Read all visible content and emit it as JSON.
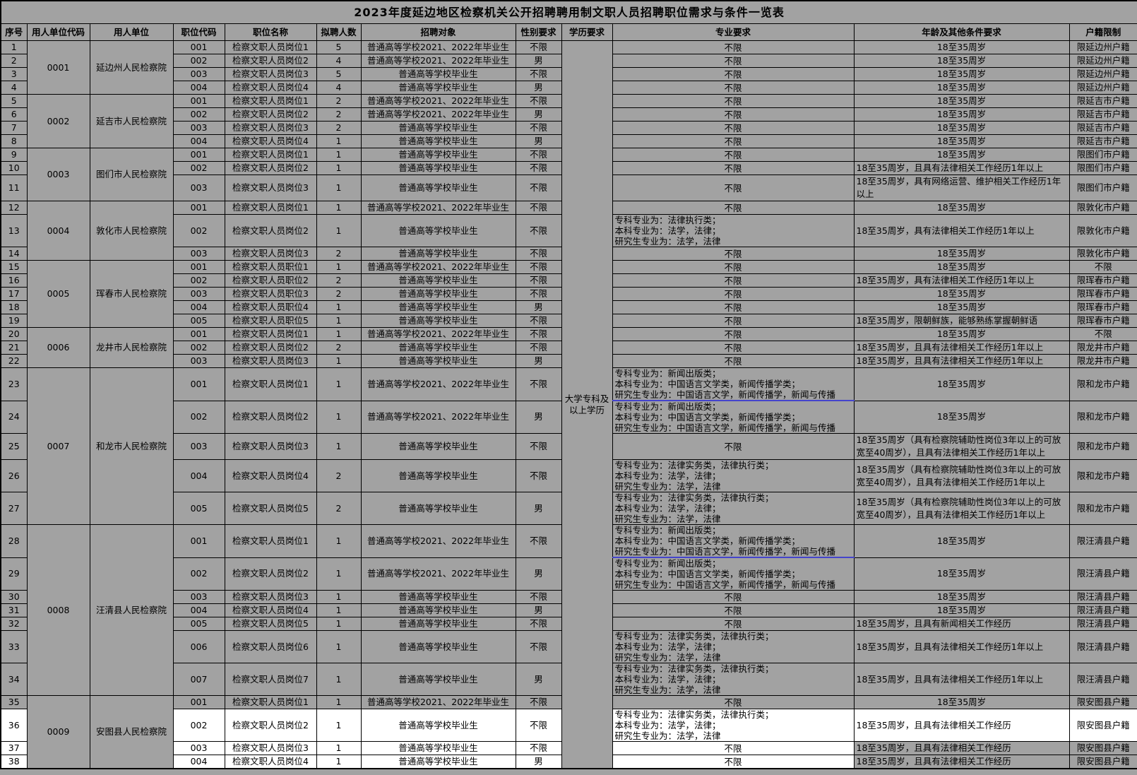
{
  "title": "2023年度延边地区检察机关公开招聘聘用制文职人员招聘职位需求与条件一览表",
  "columns": [
    "序号",
    "用人单位代码",
    "用人单位",
    "职位代码",
    "职位名称",
    "拟聘人数",
    "招聘对象",
    "性别要求",
    "学历要求",
    "专业要求",
    "年龄及其他条件要求",
    "户籍限制"
  ],
  "education_requirement": "大学专科及以上学历",
  "colors": {
    "cell_gray": "#a2a2a2",
    "highlight_white": "#ffffff",
    "border_black": "#000000",
    "blue_accent_border": "#4444cc"
  },
  "groups": [
    {
      "code": "0001",
      "employer": "延边州人民检察院",
      "rows": [
        {
          "no": "1",
          "post_code": "001",
          "post_name": "检察文职人员岗位1",
          "count": "5",
          "target": "普通高等学校2021、2022年毕业生",
          "gender": "不限",
          "major": "不限",
          "age": "18至35周岁",
          "residence": "限延边州户籍"
        },
        {
          "no": "2",
          "post_code": "002",
          "post_name": "检察文职人员岗位2",
          "count": "4",
          "target": "普通高等学校2021、2022年毕业生",
          "gender": "男",
          "major": "不限",
          "age": "18至35周岁",
          "residence": "限延边州户籍"
        },
        {
          "no": "3",
          "post_code": "003",
          "post_name": "检察文职人员岗位3",
          "count": "5",
          "target": "普通高等学校毕业生",
          "gender": "不限",
          "major": "不限",
          "age": "18至35周岁",
          "residence": "限延边州户籍"
        },
        {
          "no": "4",
          "post_code": "004",
          "post_name": "检察文职人员岗位4",
          "count": "4",
          "target": "普通高等学校毕业生",
          "gender": "男",
          "major": "不限",
          "age": "18至35周岁",
          "residence": "限延边州户籍"
        }
      ]
    },
    {
      "code": "0002",
      "employer": "延吉市人民检察院",
      "rows": [
        {
          "no": "5",
          "post_code": "001",
          "post_name": "检察文职人员岗位1",
          "count": "2",
          "target": "普通高等学校2021、2022年毕业生",
          "gender": "不限",
          "major": "不限",
          "age": "18至35周岁",
          "residence": "限延吉市户籍"
        },
        {
          "no": "6",
          "post_code": "002",
          "post_name": "检察文职人员岗位2",
          "count": "2",
          "target": "普通高等学校2021、2022年毕业生",
          "gender": "男",
          "major": "不限",
          "age": "18至35周岁",
          "residence": "限延吉市户籍"
        },
        {
          "no": "7",
          "post_code": "003",
          "post_name": "检察文职人员岗位3",
          "count": "2",
          "target": "普通高等学校毕业生",
          "gender": "不限",
          "major": "不限",
          "age": "18至35周岁",
          "residence": "限延吉市户籍"
        },
        {
          "no": "8",
          "post_code": "004",
          "post_name": "检察文职人员岗位4",
          "count": "1",
          "target": "普通高等学校毕业生",
          "gender": "男",
          "major": "不限",
          "age": "18至35周岁",
          "residence": "限延吉市户籍"
        }
      ]
    },
    {
      "code": "0003",
      "employer": "图们市人民检察院",
      "rows": [
        {
          "no": "9",
          "post_code": "001",
          "post_name": "检察文职人员岗位1",
          "count": "1",
          "target": "普通高等学校毕业生",
          "gender": "不限",
          "major": "不限",
          "age": "18至35周岁",
          "residence": "限图们市户籍"
        },
        {
          "no": "10",
          "post_code": "002",
          "post_name": "检察文职人员岗位2",
          "count": "1",
          "target": "普通高等学校毕业生",
          "gender": "不限",
          "major": "不限",
          "age": "18至35周岁，且具有法律相关工作经历1年以上",
          "residence": "限图们市户籍"
        },
        {
          "no": "11",
          "post_code": "003",
          "post_name": "检察文职人员岗位3",
          "count": "1",
          "target": "普通高等学校毕业生",
          "gender": "不限",
          "major": "不限",
          "age": "18至35周岁，具有网络运营、维护相关工作经历1年以上",
          "residence": "限图们市户籍"
        }
      ]
    },
    {
      "code": "0004",
      "employer": "敦化市人民检察院",
      "rows": [
        {
          "no": "12",
          "post_code": "001",
          "post_name": "检察文职人员岗位1",
          "count": "1",
          "target": "普通高等学校2021、2022年毕业生",
          "gender": "不限",
          "major": "不限",
          "age": "18至35周岁",
          "residence": "限敦化市户籍"
        },
        {
          "no": "13",
          "post_code": "002",
          "post_name": "检察文职人员岗位2",
          "count": "1",
          "target": "普通高等学校毕业生",
          "gender": "不限",
          "major": "专科专业为：法律执行类；\n本科专业为：法学，法律；\n研究生专业为：法学，法律",
          "age": "18至35周岁，具有法律相关工作经历1年以上",
          "residence": "限敦化市户籍"
        },
        {
          "no": "14",
          "post_code": "003",
          "post_name": "检察文职人员岗位3",
          "count": "2",
          "target": "普通高等学校毕业生",
          "gender": "不限",
          "major": "不限",
          "age": "18至35周岁",
          "residence": "限敦化市户籍"
        }
      ]
    },
    {
      "code": "0005",
      "employer": "珲春市人民检察院",
      "rows": [
        {
          "no": "15",
          "post_code": "001",
          "post_name": "检察文职人员职位1",
          "count": "1",
          "target": "普通高等学校2021、2022年毕业生",
          "gender": "不限",
          "major": "不限",
          "age": "18至35周岁",
          "residence": "不限"
        },
        {
          "no": "16",
          "post_code": "002",
          "post_name": "检察文职人员职位2",
          "count": "2",
          "target": "普通高等学校毕业生",
          "gender": "不限",
          "major": "不限",
          "age": "18至35周岁，具有法律相关工作经历1年以上",
          "residence": "限珲春市户籍"
        },
        {
          "no": "17",
          "post_code": "003",
          "post_name": "检察文职人员职位3",
          "count": "2",
          "target": "普通高等学校毕业生",
          "gender": "不限",
          "major": "不限",
          "age": "18至35周岁",
          "residence": "限珲春市户籍"
        },
        {
          "no": "18",
          "post_code": "004",
          "post_name": "检察文职人员职位4",
          "count": "1",
          "target": "普通高等学校毕业生",
          "gender": "男",
          "major": "不限",
          "age": "18至35周岁",
          "residence": "限珲春市户籍"
        },
        {
          "no": "19",
          "post_code": "005",
          "post_name": "检察文职人员职位5",
          "count": "1",
          "target": "普通高等学校毕业生",
          "gender": "不限",
          "major": "不限",
          "age": "18至35周岁，限朝鲜族，能够熟练掌握朝鲜语",
          "residence": "限珲春市户籍"
        }
      ]
    },
    {
      "code": "0006",
      "employer": "龙井市人民检察院",
      "rows": [
        {
          "no": "20",
          "post_code": "001",
          "post_name": "检察文职人员岗位1",
          "count": "1",
          "target": "普通高等学校2021、2022年毕业生",
          "gender": "不限",
          "major": "不限",
          "age": "18至35周岁",
          "residence": "不限"
        },
        {
          "no": "21",
          "post_code": "002",
          "post_name": "检察文职人员岗位2",
          "count": "2",
          "target": "普通高等学校毕业生",
          "gender": "不限",
          "major": "不限",
          "age": "18至35周岁，且具有法律相关工作经历1年以上",
          "residence": "限龙井市户籍"
        },
        {
          "no": "22",
          "post_code": "003",
          "post_name": "检察文职人员岗位3",
          "count": "1",
          "target": "普通高等学校毕业生",
          "gender": "男",
          "major": "不限",
          "age": "18至35周岁，且具有法律相关工作经历1年以上",
          "residence": "限龙井市户籍"
        }
      ]
    },
    {
      "code": "0007",
      "employer": "和龙市人民检察院",
      "rows": [
        {
          "no": "23",
          "post_code": "001",
          "post_name": "检察文职人员岗位1",
          "count": "1",
          "target": "普通高等学校2021、2022年毕业生",
          "gender": "不限",
          "major": "专科专业为：新闻出版类；\n本科专业为：中国语言文学类，新闻传播学类；\n研究生专业为：中国语言文学，新闻传播学，新闻与传播",
          "age": "18至35周岁",
          "residence": "限和龙市户籍",
          "blue": true
        },
        {
          "no": "24",
          "post_code": "002",
          "post_name": "检察文职人员岗位2",
          "count": "1",
          "target": "普通高等学校2021、2022年毕业生",
          "gender": "男",
          "major": "专科专业为：新闻出版类；\n本科专业为：中国语言文学类，新闻传播学类；\n研究生专业为：中国语言文学，新闻传播学，新闻与传播",
          "age": "18至35周岁",
          "residence": "限和龙市户籍"
        },
        {
          "no": "25",
          "post_code": "003",
          "post_name": "检察文职人员岗位3",
          "count": "1",
          "target": "普通高等学校毕业生",
          "gender": "不限",
          "major": "不限",
          "age": "18至35周岁（具有检察院辅助性岗位3年以上的可放宽至40周岁），且具有法律相关工作经历1年以上",
          "residence": "限和龙市户籍"
        },
        {
          "no": "26",
          "post_code": "004",
          "post_name": "检察文职人员岗位4",
          "count": "2",
          "target": "普通高等学校毕业生",
          "gender": "不限",
          "major": "专科专业为：法律实务类，法律执行类；\n本科专业为：法学，法律；\n研究生专业为：法学，法律",
          "age": "18至35周岁（具有检察院辅助性岗位3年以上的可放宽至40周岁），且具有法律相关工作经历1年以上",
          "residence": "限和龙市户籍"
        },
        {
          "no": "27",
          "post_code": "005",
          "post_name": "检察文职人员岗位5",
          "count": "2",
          "target": "普通高等学校毕业生",
          "gender": "男",
          "major": "专科专业为：法律实务类，法律执行类；\n本科专业为：法学，法律；\n研究生专业为：法学，法律",
          "age": "18至35周岁（具有检察院辅助性岗位3年以上的可放宽至40周岁），且具有法律相关工作经历1年以上",
          "residence": "限和龙市户籍"
        }
      ]
    },
    {
      "code": "0008",
      "employer": "汪清县人民检察院",
      "rows": [
        {
          "no": "28",
          "post_code": "001",
          "post_name": "检察文职人员岗位1",
          "count": "1",
          "target": "普通高等学校2021、2022年毕业生",
          "gender": "不限",
          "major": "专科专业为：新闻出版类；\n本科专业为：中国语言文学类，新闻传播学类；\n研究生专业为：中国语言文学，新闻传播学，新闻与传播",
          "age": "18至35周岁",
          "residence": "限汪清县户籍",
          "blue": true
        },
        {
          "no": "29",
          "post_code": "002",
          "post_name": "检察文职人员岗位2",
          "count": "1",
          "target": "普通高等学校2021、2022年毕业生",
          "gender": "男",
          "major": "专科专业为：新闻出版类；\n本科专业为：中国语言文学类，新闻传播学类；\n研究生专业为：中国语言文学，新闻传播学，新闻与传播",
          "age": "18至35周岁",
          "residence": "限汪清县户籍"
        },
        {
          "no": "30",
          "post_code": "003",
          "post_name": "检察文职人员岗位3",
          "count": "1",
          "target": "普通高等学校毕业生",
          "gender": "不限",
          "major": "不限",
          "age": "18至35周岁",
          "residence": "限汪清县户籍"
        },
        {
          "no": "31",
          "post_code": "004",
          "post_name": "检察文职人员岗位4",
          "count": "1",
          "target": "普通高等学校毕业生",
          "gender": "男",
          "major": "不限",
          "age": "18至35周岁",
          "residence": "限汪清县户籍"
        },
        {
          "no": "32",
          "post_code": "005",
          "post_name": "检察文职人员岗位5",
          "count": "1",
          "target": "普通高等学校毕业生",
          "gender": "不限",
          "major": "不限",
          "age": "18至35周岁，且具有新闻相关工作经历",
          "residence": "限汪清县户籍"
        },
        {
          "no": "33",
          "post_code": "006",
          "post_name": "检察文职人员岗位6",
          "count": "1",
          "target": "普通高等学校毕业生",
          "gender": "不限",
          "major": "专科专业为：法律实务类，法律执行类；\n本科专业为：法学，法律；\n研究生专业为：法学，法律",
          "age": "18至35周岁，且具有法律相关工作经历1年以上",
          "residence": "限汪清县户籍"
        },
        {
          "no": "34",
          "post_code": "007",
          "post_name": "检察文职人员岗位7",
          "count": "1",
          "target": "普通高等学校毕业生",
          "gender": "男",
          "major": "专科专业为：法律实务类，法律执行类；\n本科专业为：法学，法律；\n研究生专业为：法学，法律",
          "age": "18至35周岁，且具有法律相关工作经历1年以上",
          "residence": "限汪清县户籍"
        }
      ]
    },
    {
      "code": "0009",
      "employer": "安图县人民检察院",
      "rows": [
        {
          "no": "35",
          "post_code": "001",
          "post_name": "检察文职人员岗位1",
          "count": "1",
          "target": "普通高等学校2021、2022年毕业生",
          "gender": "不限",
          "major": "不限",
          "age": "18至35周岁",
          "residence": "限安图县户籍"
        },
        {
          "no": "36",
          "post_code": "002",
          "post_name": "检察文职人员岗位2",
          "count": "1",
          "target": "普通高等学校毕业生",
          "gender": "不限",
          "major": "专科专业为：法律实务类，法律执行类；\n本科专业为：法学，法律；\n研究生专业为：法学，法律",
          "age": "18至35周岁，且具有法律相关工作经历",
          "residence": "限安图县户籍",
          "hl": "full"
        },
        {
          "no": "37",
          "post_code": "003",
          "post_name": "检察文职人员岗位3",
          "count": "1",
          "target": "普通高等学校毕业生",
          "gender": "不限",
          "major": "不限",
          "age": "18至35周岁，且具有法律相关工作经历",
          "residence": "限安图县户籍",
          "hl": "partial"
        },
        {
          "no": "38",
          "post_code": "004",
          "post_name": "检察文职人员岗位4",
          "count": "1",
          "target": "普通高等学校毕业生",
          "gender": "男",
          "major": "不限",
          "age": "18至35周岁，且具有法律相关工作经历",
          "residence": "限安图县户籍",
          "hl": "partial"
        }
      ]
    }
  ]
}
